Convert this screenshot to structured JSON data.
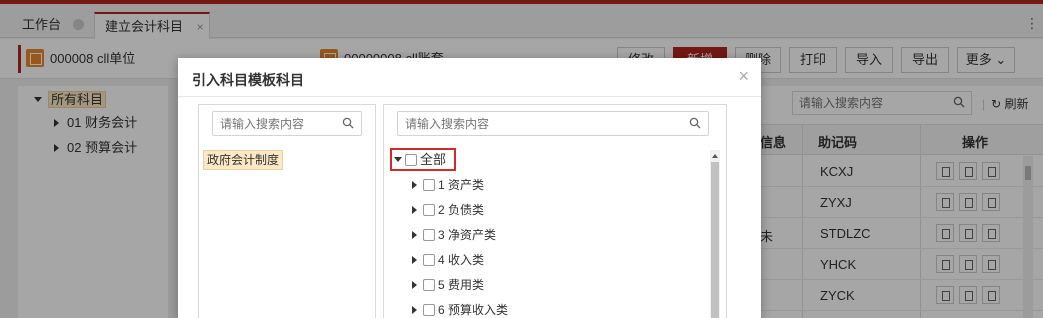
{
  "tabs": {
    "workbench": "工作台",
    "active": "建立会计科目",
    "close_symbol": "×"
  },
  "org": {
    "unit": "000008 cll单位",
    "book": "00000008 cll账套"
  },
  "toolbar": {
    "modify": "修改",
    "add": "新增",
    "delete": "删除",
    "print": "打印",
    "import": "导入",
    "export": "导出",
    "more": "更多 ⌄"
  },
  "left_tree": {
    "root": "所有科目",
    "items": [
      "01 财务会计",
      "02 预算会计"
    ]
  },
  "main": {
    "search_placeholder": "请输入搜索内容",
    "refresh": "刷新",
    "columns": {
      "info": "信息",
      "mnemonic": "助记码",
      "ops": "操作"
    },
    "rows": [
      {
        "pre": "",
        "code": "KCXJ"
      },
      {
        "pre": "",
        "code": "ZYXJ"
      },
      {
        "pre": "未",
        "code": "STDLZC"
      },
      {
        "pre": "",
        "code": "YHCK"
      },
      {
        "pre": "",
        "code": "ZYCK"
      }
    ]
  },
  "dialog": {
    "title": "引入科目模板科目",
    "close": "×",
    "template_search_placeholder": "请输入搜索内容",
    "template_items": [
      "政府会计制度"
    ],
    "account_search_placeholder": "请输入搜索内容",
    "tree_root": "全部",
    "tree_items": [
      "1 资产类",
      "2 负债类",
      "3 净资产类",
      "4 收入类",
      "5 费用类",
      "6 预算收入类"
    ]
  },
  "colors": {
    "brand": "#b3261e",
    "highlight_bg": "#fce8c4",
    "annotation_red": "#d42a2a"
  }
}
